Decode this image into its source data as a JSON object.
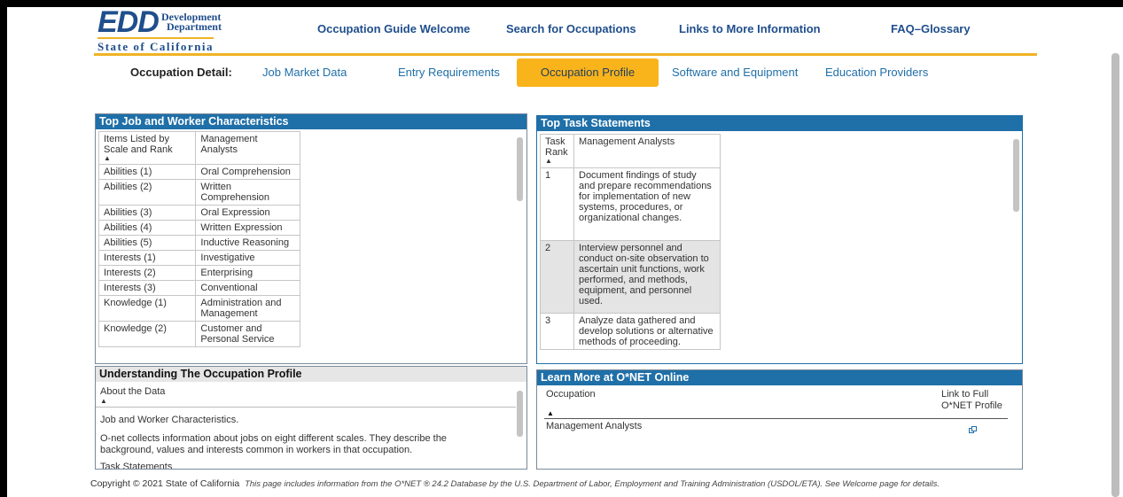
{
  "logo": {
    "edd": "EDD",
    "dept_line1": "Development",
    "dept_line2": "Department",
    "state": "State of California"
  },
  "topnav": [
    "Occupation Guide Welcome",
    "Search for Occupations",
    "Links to More Information",
    "FAQ–Glossary"
  ],
  "subnav": {
    "label": "Occupation Detail:",
    "tabs": [
      "Job Market Data",
      "Entry Requirements",
      "Occupation Profile",
      "Software and Equipment",
      "Education Providers"
    ],
    "active": "Occupation Profile"
  },
  "characteristics": {
    "title": "Top Job and Worker Characteristics",
    "col1": "Items Listed by Scale and Rank",
    "col2": "Management Analysts",
    "rows": [
      [
        "Abilities (1)",
        "Oral Comprehension"
      ],
      [
        "Abilities (2)",
        "Written Comprehension"
      ],
      [
        "Abilities (3)",
        "Oral Expression"
      ],
      [
        "Abilities (4)",
        "Written Expression"
      ],
      [
        "Abilities (5)",
        "Inductive Reasoning"
      ],
      [
        "Interests (1)",
        "Investigative"
      ],
      [
        "Interests (2)",
        "Enterprising"
      ],
      [
        "Interests (3)",
        "Conventional"
      ],
      [
        "Knowledge (1)",
        "Administration and Management"
      ],
      [
        "Knowledge (2)",
        "Customer and Personal Service"
      ]
    ]
  },
  "tasks": {
    "title": "Top Task Statements",
    "col1": "Task Rank",
    "col2": "Management Analysts",
    "rows": [
      [
        "1",
        "Document findings of study and prepare recommendations for implementation of new systems, procedures, or organizational changes."
      ],
      [
        "2",
        "Interview personnel and conduct on-site observation to ascertain unit functions, work performed, and methods, equipment, and personnel used."
      ],
      [
        "3",
        "Analyze data gathered and develop solutions or alternative methods of proceeding."
      ]
    ]
  },
  "understanding": {
    "title": "Understanding The Occupation Profile",
    "about": "About the Data",
    "p1": "Job and Worker Characteristics.",
    "p2": "O-net collects information about jobs on eight different scales. They describe the background, values and interests common in workers in that occupation.",
    "p3": "Task Statements"
  },
  "onet": {
    "title": "Learn More at O*NET Online",
    "col1": "Occupation",
    "col2": "Link to Full O*NET Profile",
    "row_occupation": "Management Analysts",
    "link_icon": "external-link-icon"
  },
  "footer": {
    "copyright": "Copyright © 2021 State of California",
    "note": "This page includes information from the O*NET ® 24.2 Database by the U.S. Department of Labor, Employment and Training Administration (USDOL/ETA). See Welcome page for details."
  }
}
